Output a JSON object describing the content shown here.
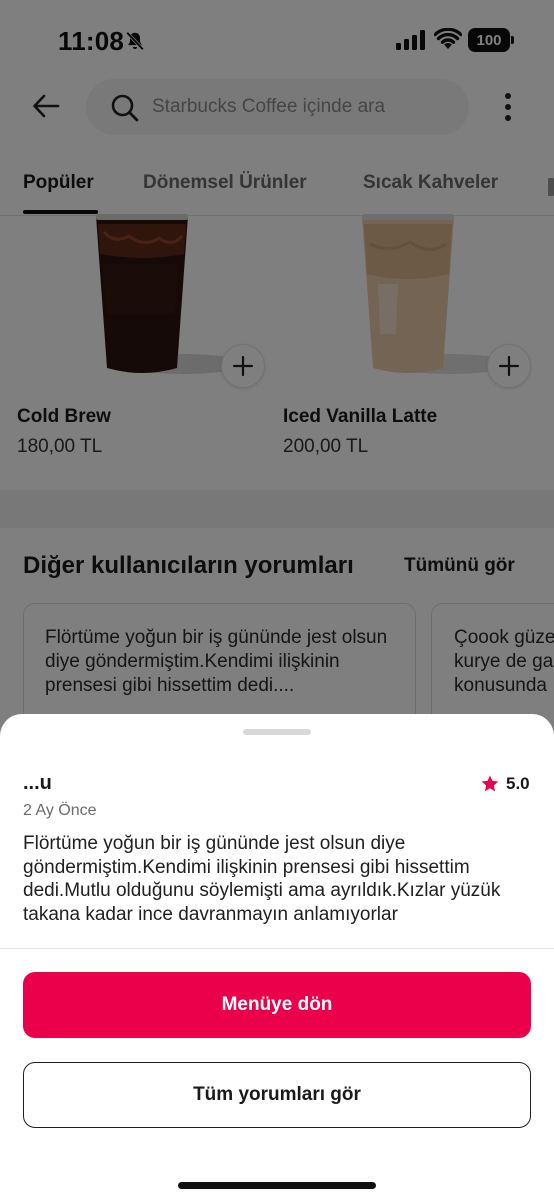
{
  "status_bar": {
    "time": "11:08",
    "battery": "100",
    "icons": [
      "bell-slash-icon",
      "cellular-signal-icon",
      "wifi-icon",
      "battery-icon"
    ]
  },
  "header": {
    "back_icon": "arrow-left-icon",
    "search_placeholder": "Starbucks Coffee içinde ara",
    "search_icon": "search-icon",
    "more_icon": "more-vertical-icon"
  },
  "tabs": [
    {
      "label": "Popüler",
      "active": true
    },
    {
      "label": "Dönemsel Ürünler",
      "active": false
    },
    {
      "label": "Sıcak Kahveler",
      "active": false
    }
  ],
  "products": [
    {
      "name": "Cold Brew",
      "price": "180,00 TL",
      "image": "cold-brew-image"
    },
    {
      "name": "Iced Vanilla Latte",
      "price": "200,00 TL",
      "image": "iced-vanilla-latte-image"
    }
  ],
  "reviews_section": {
    "title": "Diğer kullanıcıların yorumları",
    "see_all": "Tümünü gör",
    "cards": [
      {
        "text": "Flörtüme yoğun bir iş gününde jest olsun diye göndermiştim.Kendimi ilişkinin prensesi gibi hissettim dedi...."
      },
      {
        "text": "Çoook güze kurye de ga konusunda"
      }
    ]
  },
  "review_sheet": {
    "reviewer": "...u",
    "rating": "5.0",
    "date": "2 Ay Önce",
    "body": "Flörtüme yoğun bir iş gününde jest olsun diye göndermiştim.Kendimi ilişkinin prensesi gibi hissettim dedi.Mutlu olduğunu söylemişti ama ayrıldık.Kızlar yüzük takana kadar ince davranmayın anlamıyorlar",
    "primary_button": "Menüye dön",
    "secondary_button": "Tüm yorumları gör"
  },
  "colors": {
    "accent": "#ea004b",
    "overlay": "rgba(0,0,0,0.5)",
    "star": "#ea004b"
  }
}
